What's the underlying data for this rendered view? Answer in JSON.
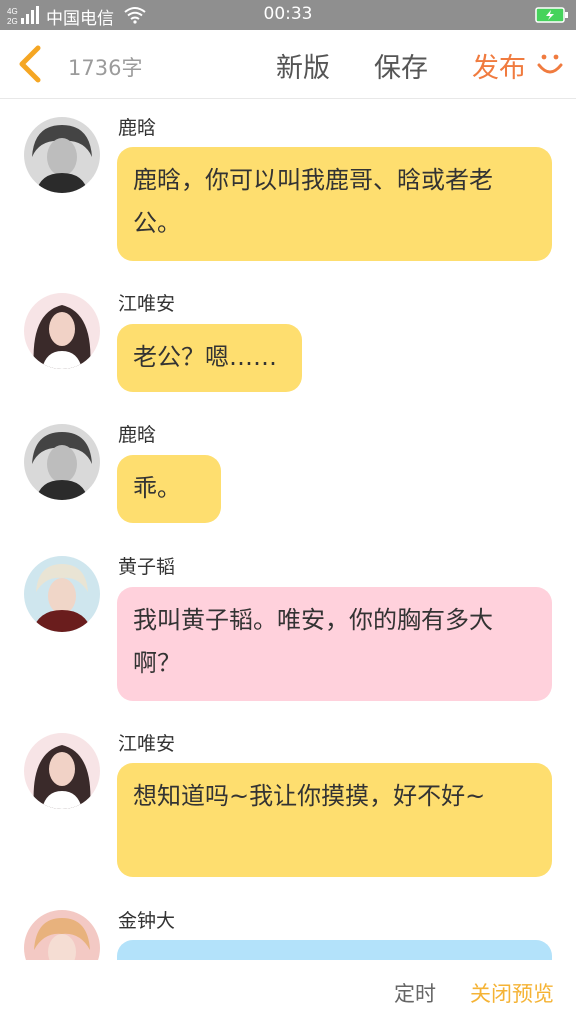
{
  "status_bar": {
    "signal_label": "4G 2G",
    "carrier": "中国电信",
    "time": "00:33",
    "battery_icon": "charging-battery-icon"
  },
  "top_bar": {
    "back_icon": "chevron-left-icon",
    "word_count": "1736字",
    "new_label": "新版",
    "save_label": "保存",
    "publish_label": "发布",
    "smile_icon": "smile-icon",
    "accent_color": "#f07b3f"
  },
  "messages": [
    {
      "name": "鹿晗",
      "text": "鹿晗，你可以叫我鹿哥、晗或者老公。",
      "bubble_color": "yellow",
      "avatar": "male-bw-portrait"
    },
    {
      "name": "江唯安",
      "text": "老公？嗯……",
      "bubble_color": "yellow",
      "avatar": "female-portrait"
    },
    {
      "name": "鹿晗",
      "text": "乖。",
      "bubble_color": "yellow",
      "avatar": "male-bw-portrait"
    },
    {
      "name": "黄子韬",
      "text": "我叫黄子韬。唯安，你的胸有多大啊？",
      "bubble_color": "pink",
      "avatar": "male-blonde-portrait"
    },
    {
      "name": "江唯安",
      "text": "想知道吗~我让你摸摸，好不好~",
      "bubble_color": "yellow",
      "avatar": "female-portrait"
    },
    {
      "name": "金钟大",
      "text": "",
      "bubble_color": "blue",
      "avatar": "male-pink-portrait"
    }
  ],
  "bottom_bar": {
    "timer_label": "定时",
    "close_preview_label": "关闭预览"
  },
  "colors": {
    "yellow_bubble": "#fede6f",
    "pink_bubble": "#ffd1dc",
    "blue_bubble": "#b3e2fa",
    "close_preview": "#f5b335"
  }
}
